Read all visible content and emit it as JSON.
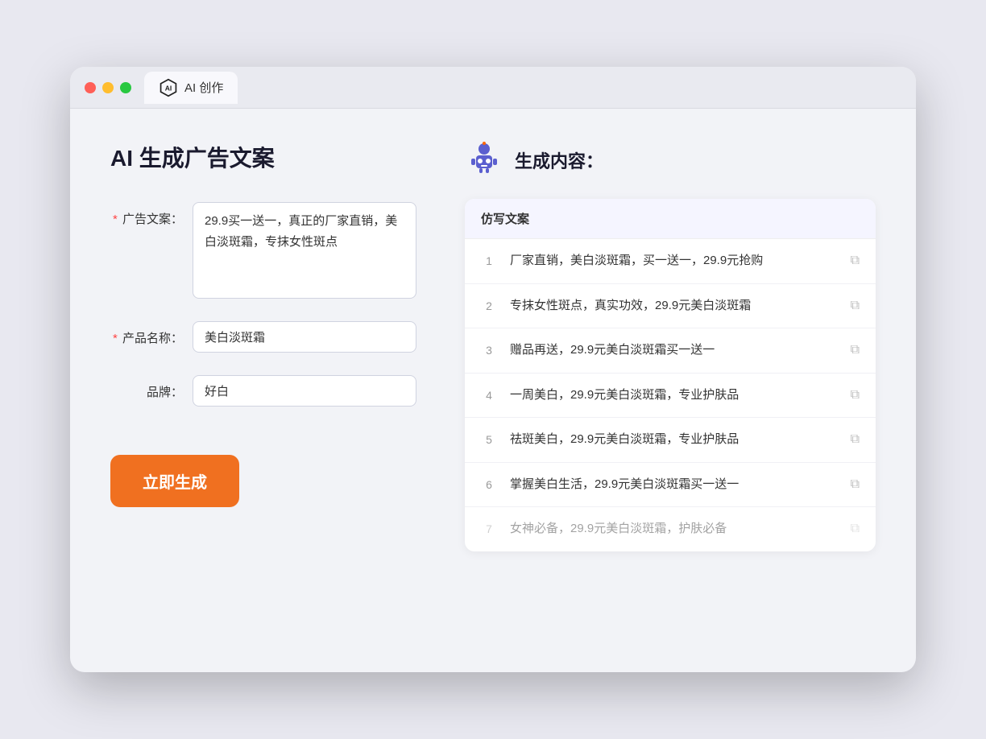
{
  "window": {
    "tab_label": "AI 创作"
  },
  "page": {
    "title": "AI 生成广告文案",
    "generate_button": "立即生成"
  },
  "form": {
    "ad_copy_label": "广告文案：",
    "ad_copy_required": true,
    "ad_copy_value": "29.9买一送一，真正的厂家直销，美白淡斑霜，专抹女性斑点",
    "product_name_label": "产品名称：",
    "product_name_required": true,
    "product_name_value": "美白淡斑霜",
    "brand_label": "品牌：",
    "brand_required": false,
    "brand_value": "好白"
  },
  "results": {
    "section_header": "仿写文案",
    "right_title": "生成内容：",
    "items": [
      {
        "num": 1,
        "text": "厂家直销，美白淡斑霜，买一送一，29.9元抢购",
        "faded": false
      },
      {
        "num": 2,
        "text": "专抹女性斑点，真实功效，29.9元美白淡斑霜",
        "faded": false
      },
      {
        "num": 3,
        "text": "赠品再送，29.9元美白淡斑霜买一送一",
        "faded": false
      },
      {
        "num": 4,
        "text": "一周美白，29.9元美白淡斑霜，专业护肤品",
        "faded": false
      },
      {
        "num": 5,
        "text": "祛斑美白，29.9元美白淡斑霜，专业护肤品",
        "faded": false
      },
      {
        "num": 6,
        "text": "掌握美白生活，29.9元美白淡斑霜买一送一",
        "faded": false
      },
      {
        "num": 7,
        "text": "女神必备，29.9元美白淡斑霜，护肤必备",
        "faded": true
      }
    ]
  }
}
